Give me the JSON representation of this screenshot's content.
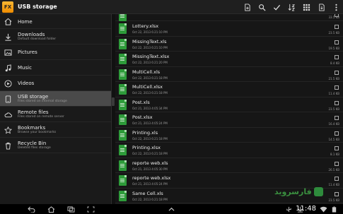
{
  "app": {
    "icon_label": "FX",
    "title": "USB storage"
  },
  "actionbar": {
    "actions": [
      "new-file-icon",
      "search-icon",
      "checkmark-icon",
      "sort-icon",
      "grid-view-icon",
      "sd-card-icon",
      "overflow-menu-icon"
    ]
  },
  "drawer": {
    "items": [
      {
        "label": "Home",
        "sub": "",
        "icon": "home-icon"
      },
      {
        "label": "Downloads",
        "sub": "Default download folder",
        "icon": "download-icon"
      },
      {
        "label": "Pictures",
        "sub": "",
        "icon": "picture-icon"
      },
      {
        "label": "Music",
        "sub": "",
        "icon": "music-icon"
      },
      {
        "label": "Videos",
        "sub": "",
        "icon": "video-icon"
      },
      {
        "label": "USB storage",
        "sub": "Files stored on internal storage",
        "icon": "phone-storage-icon"
      },
      {
        "label": "Remote files",
        "sub": "Files stored on remote server",
        "icon": "cloud-icon"
      },
      {
        "label": "Bookmarks",
        "sub": "Browse your bookmarks",
        "icon": "star-icon"
      },
      {
        "label": "Recycle Bin",
        "sub": "Deleted files storage",
        "icon": "trash-icon"
      }
    ]
  },
  "files": {
    "first_size": "33.5 KB",
    "rows": [
      {
        "name": "Lottery.xlsx",
        "date": "Oct 22, 2013 6:21:10 PM",
        "size": "23.5 KB"
      },
      {
        "name": "MissingText.xls",
        "date": "Oct 22, 2013 6:21:10 PM",
        "size": "19.5 KB"
      },
      {
        "name": "MissingText.xlsx",
        "date": "Oct 22, 2013 6:21:20 PM",
        "size": "8.4 KB"
      },
      {
        "name": "MultiCell.xls",
        "date": "Oct 22, 2013 6:21:18 PM",
        "size": "21.5 KB"
      },
      {
        "name": "MultiCell.xlsx",
        "date": "Oct 22, 2013 6:21:18 PM",
        "size": "11.4 KB"
      },
      {
        "name": "Post.xls",
        "date": "Oct 21, 2013 4:05:34 PM",
        "size": "23.5 KB"
      },
      {
        "name": "Post.xlsx",
        "date": "Oct 21, 2013 4:05:24 PM",
        "size": "16.4 KB"
      },
      {
        "name": "Printing.xls",
        "date": "Oct 22, 2013 6:21:18 PM",
        "size": "14.5 KB"
      },
      {
        "name": "Printing.xlsx",
        "date": "Oct 22, 2013 6:21:18 PM",
        "size": "8.1 KB"
      },
      {
        "name": "reporte web.xls",
        "date": "Oct 21, 2013 4:05:30 PM",
        "size": "26.5 KB"
      },
      {
        "name": "reporte web.xlsx",
        "date": "Oct 21, 2013 4:05:24 PM",
        "size": "11.4 KB"
      },
      {
        "name": "Same Cell.xls",
        "date": "Oct 22, 2013 6:21:18 PM",
        "size": "23.5 KB"
      }
    ]
  },
  "watermark": {
    "text": "فارسروید"
  },
  "system": {
    "time": "11:48"
  }
}
